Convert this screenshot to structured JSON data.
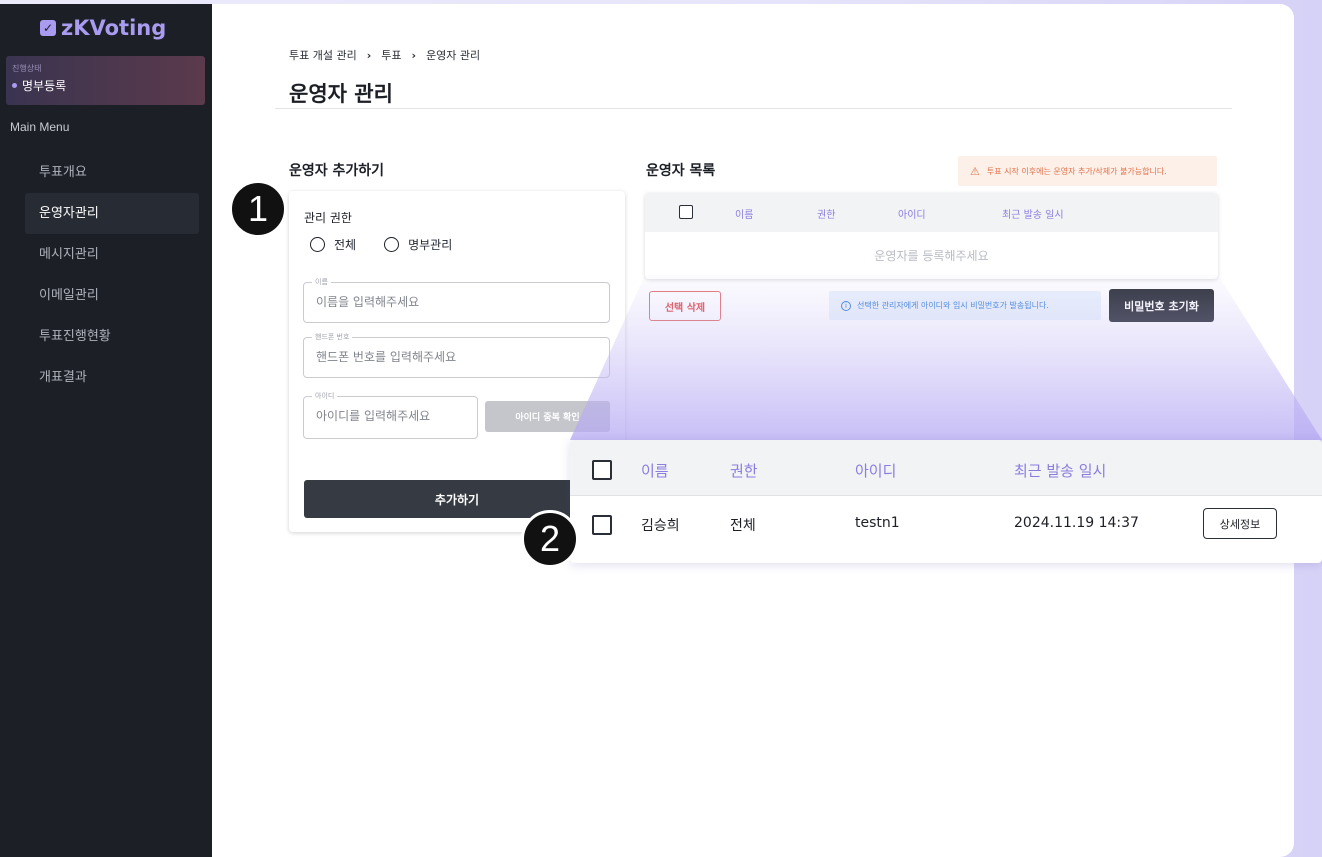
{
  "app": {
    "logo_text": "zKVoting",
    "logo_check": "✓"
  },
  "sidebar": {
    "status_label": "진행상태",
    "status_value": "명부등록",
    "menu_title": "Main Menu",
    "items": [
      {
        "label": "투표개요"
      },
      {
        "label": "운영자관리",
        "active": true
      },
      {
        "label": "메시지관리"
      },
      {
        "label": "이메일관리"
      },
      {
        "label": "투표진행현황"
      },
      {
        "label": "개표결과"
      }
    ]
  },
  "breadcrumb": [
    "투표 개설 관리",
    "투표",
    "운영자 관리"
  ],
  "breadcrumb_sep": "›",
  "page_title": "운영자 관리",
  "add_panel": {
    "title": "운영자 추가하기",
    "permission_label": "관리 권한",
    "radio_options": [
      "전체",
      "명부관리"
    ],
    "name_legend": "이름",
    "name_placeholder": "이름을 입력해주세요",
    "phone_legend": "핸드폰 번호",
    "phone_placeholder": "핸드폰 번호를 입력해주세요",
    "id_legend": "아이디",
    "id_placeholder": "아이디를 입력해주세요",
    "dup_check_button": "아이디 중복 확인",
    "add_button": "추가하기"
  },
  "list_panel": {
    "title": "운영자 목록",
    "warning": "투표 시작 이후에는 운영자 추가/삭제가 불가능합니다.",
    "columns": [
      "이름",
      "권한",
      "아이디",
      "최근 발송 일시"
    ],
    "empty_message": "운영자를 등록해주세요",
    "delete_button": "선택 삭제",
    "info": "선택한 관리자에게 아이디와 임시 비밀번호가 발송됩니다.",
    "reset_button": "비밀번호 초기화"
  },
  "zoom": {
    "columns": [
      "이름",
      "권한",
      "아이디",
      "최근 발송 일시"
    ],
    "row": {
      "name": "김승희",
      "permission": "전체",
      "id": "testn1",
      "sent_at": "2024.11.19 14:37"
    },
    "detail_button": "상세정보"
  },
  "markers": [
    "1",
    "2"
  ],
  "colors": {
    "accent": "#8a7de0",
    "sidebar": "#1c1f26",
    "danger": "#e05050",
    "info": "#3b82d8",
    "warning": "#e0724a"
  }
}
